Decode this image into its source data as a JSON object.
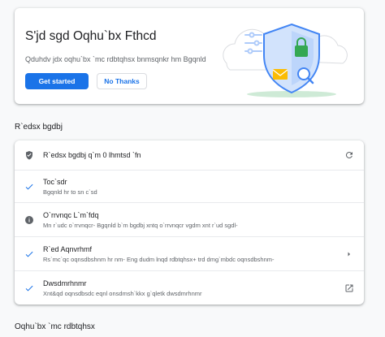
{
  "promo": {
    "title": "S'jd sgd Oqhu`bx Fthcd",
    "description": "Qduhdv jdx oqhu`bx `mc rdbtqhsx bnmsqnkr hm Bgqnld",
    "primary_button": "Get started",
    "secondary_button": "No Thanks",
    "illustration_icons": [
      "shield-icon",
      "lock-icon",
      "envelope-icon",
      "magnifier-icon",
      "sliders-icon",
      "cloud-icon"
    ]
  },
  "safety_check": {
    "heading": "R`edsx bgdbj",
    "items": [
      {
        "title": "R`edsx bgdbj q`m 0 lhmtsd `fn",
        "subtitle": "",
        "icon": "shield-icon",
        "action_icon": "refresh-icon"
      },
      {
        "title": "Toc`sdr",
        "subtitle": "Bgqnld hr to sn c`sd",
        "icon": "check-icon",
        "action_icon": ""
      },
      {
        "title": "O`rrvnqc L`m`fdq",
        "subtitle": "Mn r`udc o`rrvnqcr- Bgqnld b`m bgdbj xntq o`rrvnqcr vgdm xnt r`ud sgdl-",
        "icon": "info-icon",
        "action_icon": ""
      },
      {
        "title": "R`ed Aqnvrhmf",
        "subtitle": "Rs`mc`qc oqnsdbshnm hr nm- Eng dudm lnqd rdbtqhsx+ trd dmg`mbdc oqnsdbshnm-",
        "icon": "check-icon",
        "action_icon": "chevron-right-icon"
      },
      {
        "title": "Dwsdmrhnmr",
        "subtitle": "Xnt&qd oqnsdbsdc eqnl onsdmsh`kkx g`qletk dwsdmrhnmr",
        "icon": "check-icon",
        "action_icon": "open-in-new-icon"
      }
    ]
  },
  "privacy_section": {
    "heading": "Oqhu`bx `mc rdbtqhsx"
  },
  "colors": {
    "accent": "#1a73e8",
    "text_primary": "#202124",
    "text_secondary": "#5f6368",
    "illustration_green": "#34a853",
    "illustration_yellow": "#fbbc04"
  }
}
